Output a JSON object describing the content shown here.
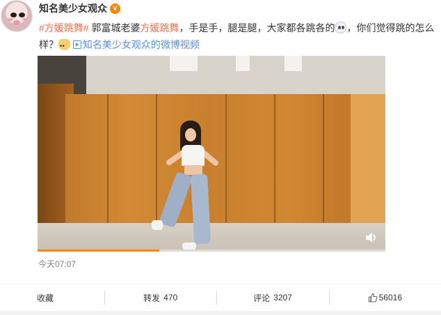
{
  "post": {
    "username": "知名美少女观众",
    "verified_badge": "V",
    "topic_1": "#方媛跳舞#",
    "text_1": " 郭富城老婆",
    "topic_2": "方媛跳舞",
    "text_2": "，手是手，腿是腿，大家都各跳各的",
    "text_3": "，你们觉得跳的怎么样？",
    "video_link_text": "知名美少女观众的微博视频",
    "emoji_1": "dizzy-face-icon",
    "emoji_2": "doge-icon",
    "timestamp": "今天07:07"
  },
  "video": {
    "progress_percent": 35,
    "volume_icon": "volume-icon"
  },
  "actions": {
    "favorite_label": "收藏",
    "repost_label": "转发",
    "repost_count": "470",
    "comment_label": "评论",
    "comment_count": "3207",
    "like_count": "56016",
    "like_icon": "thumbs-up-icon"
  },
  "colors": {
    "topic": "#eb7350",
    "link": "#5a8fe0",
    "progress": "#ff8200",
    "badge": "#ff8200"
  }
}
